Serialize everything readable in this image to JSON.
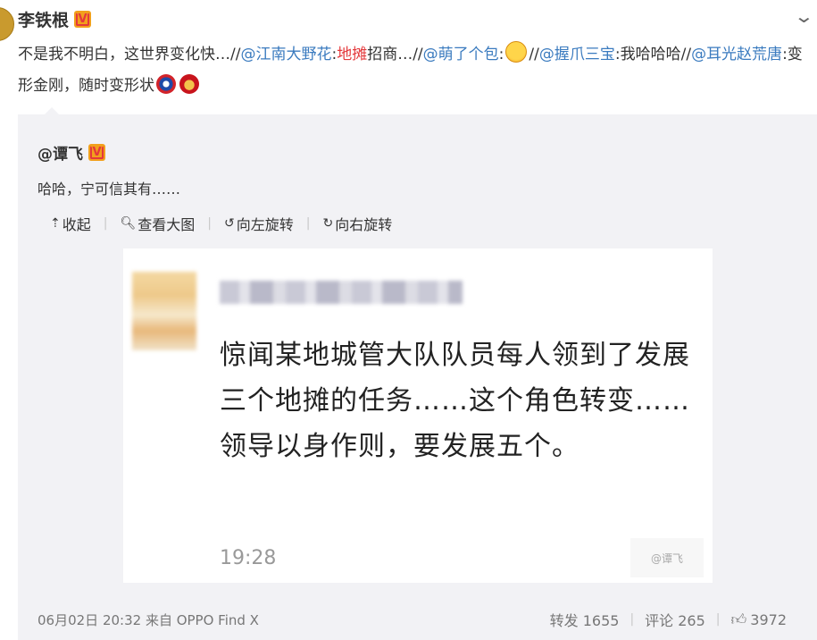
{
  "post": {
    "author": "李铁根",
    "verified": "V",
    "segments": [
      {
        "text": "不是我不明白，这世界变化快…//",
        "type": "text"
      },
      {
        "text": "@江南大野花",
        "type": "mention"
      },
      {
        "text": ":",
        "type": "text"
      },
      {
        "text": "地摊",
        "type": "red"
      },
      {
        "text": "招商…//",
        "type": "text"
      },
      {
        "text": "@萌了个包",
        "type": "mention"
      },
      {
        "text": ":",
        "type": "text"
      },
      {
        "text": "",
        "type": "emoji-laugh"
      },
      {
        "text": "//",
        "type": "text"
      },
      {
        "text": "@握爪三宝",
        "type": "mention"
      },
      {
        "text": ":我哈哈哈//",
        "type": "text"
      },
      {
        "text": "@耳光赵荒唐",
        "type": "mention"
      },
      {
        "text": ":变形金刚，随时变形状",
        "type": "text"
      },
      {
        "text": "",
        "type": "emoji-cap"
      },
      {
        "text": "",
        "type": "emoji-iron"
      }
    ]
  },
  "repost": {
    "author": "@谭飞",
    "verified": "V",
    "text": "哈哈，宁可信其有……",
    "toolbar": {
      "collapse": "收起",
      "view_large": "查看大图",
      "rotate_left": "向左旋转",
      "rotate_right": "向右旋转"
    },
    "image": {
      "message": "惊闻某地城管大队队员每人领到了发展三个地摊的任务……这个角色转变……领导以身作则，要发展五个。",
      "time": "19:28",
      "watermark": "@谭飞"
    },
    "footer": {
      "meta": "06月02日 20:32 来自 OPPO Find X",
      "forward": "转发 1655",
      "comment": "评论 265",
      "like": "3972"
    }
  },
  "colors": {
    "mention": "#3b7bbf",
    "highlight": "#e4393c",
    "repost_bg": "#f2f2f5"
  }
}
